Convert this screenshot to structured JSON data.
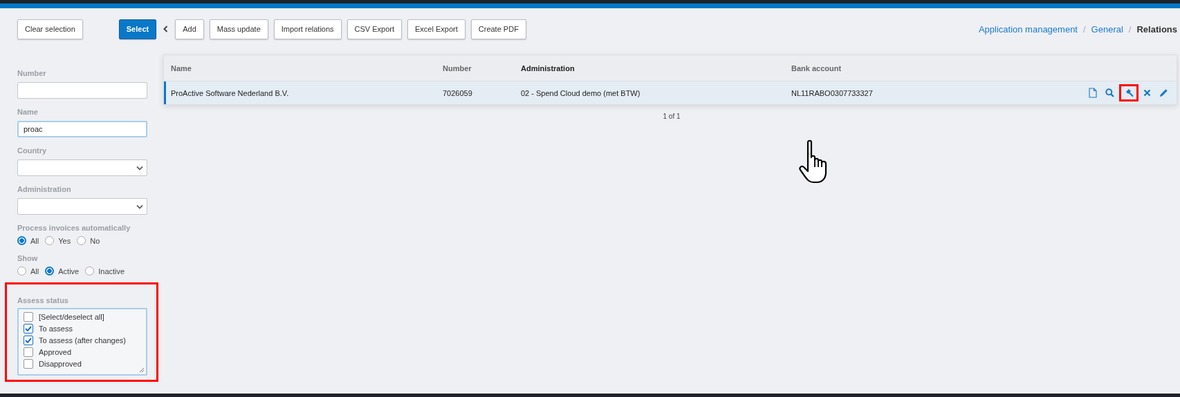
{
  "toolbar": {
    "buttons": [
      {
        "label": "Clear selection",
        "primary": false
      },
      {
        "label": "Select",
        "primary": true
      },
      {
        "label": "Add",
        "primary": false
      },
      {
        "label": "Mass update",
        "primary": false
      },
      {
        "label": "Import relations",
        "primary": false
      },
      {
        "label": "CSV Export",
        "primary": false
      },
      {
        "label": "Excel Export",
        "primary": false
      },
      {
        "label": "Create PDF",
        "primary": false
      }
    ]
  },
  "breadcrumb": [
    {
      "kind": "link",
      "label": "Application management"
    },
    {
      "kind": "separator",
      "label": "/"
    },
    {
      "kind": "link",
      "label": "General"
    },
    {
      "kind": "separator",
      "label": "/"
    },
    {
      "kind": "current",
      "label": "Relations"
    }
  ],
  "filters": [
    {
      "kind": "text",
      "label": "Number",
      "focused": false,
      "highlighted": false
    },
    {
      "kind": "text",
      "label": "Name",
      "value": "proac",
      "focused": true,
      "highlighted": false
    },
    {
      "kind": "select",
      "label": "Country",
      "highlighted": false
    },
    {
      "kind": "select",
      "label": "Administration",
      "highlighted": false
    },
    {
      "kind": "radio",
      "label": "Process invoices automatically",
      "highlighted": false,
      "options": [
        {
          "label": "All",
          "selected": true
        },
        {
          "label": "Yes",
          "selected": false
        },
        {
          "label": "No",
          "selected": false
        }
      ]
    },
    {
      "kind": "radio",
      "label": "Show",
      "highlighted": false,
      "options": [
        {
          "label": "All",
          "selected": false
        },
        {
          "label": "Active",
          "selected": true
        },
        {
          "label": "Inactive",
          "selected": false
        }
      ]
    },
    {
      "kind": "checklist",
      "label": "Assess status",
      "highlighted": true,
      "options": [
        {
          "label": "[Select/deselect all]",
          "checked": false
        },
        {
          "label": "To assess",
          "checked": true
        },
        {
          "label": "To assess (after changes)",
          "checked": true
        },
        {
          "label": "Approved",
          "checked": false
        },
        {
          "label": "Disapproved",
          "checked": false
        }
      ]
    }
  ],
  "table": {
    "columns": [
      {
        "label": "Name",
        "sorted": false
      },
      {
        "label": "Number",
        "sorted": false
      },
      {
        "label": "Administration",
        "sorted": true
      },
      {
        "label": "Bank account",
        "sorted": false
      }
    ],
    "rows": [
      {
        "selected": true,
        "cells": [
          "ProActive Software Nederland B.V.",
          "7026059",
          "02 - Spend Cloud demo (met BTW)",
          "NL11RABO0307733327"
        ],
        "actions": [
          {
            "kind": "document",
            "highlighted": false
          },
          {
            "kind": "search",
            "highlighted": false
          },
          {
            "kind": "gavel",
            "highlighted": true
          },
          {
            "kind": "delete",
            "highlighted": false
          },
          {
            "kind": "edit",
            "highlighted": false
          }
        ]
      }
    ],
    "pagination": "1 of 1"
  }
}
